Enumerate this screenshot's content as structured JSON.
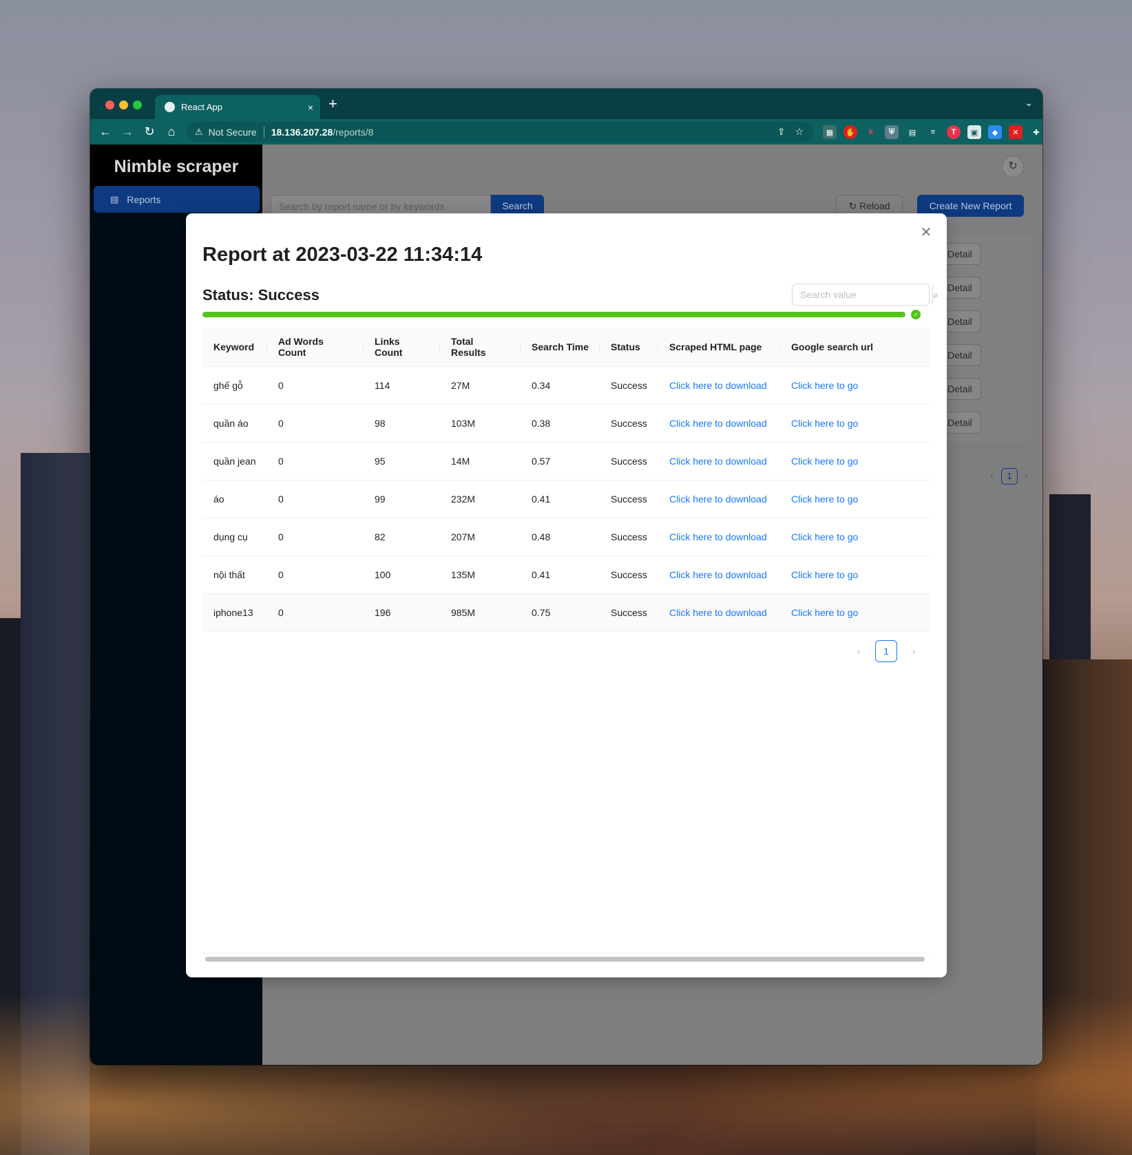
{
  "browser": {
    "tab_title": "React App",
    "tab_close": "×",
    "new_tab": "+",
    "tabs_menu": "⌄",
    "not_secure": "Not Secure",
    "url_host": "18.136.207.28",
    "url_path": "/reports/8"
  },
  "app": {
    "brand": "Nimble scraper",
    "menu_reports": "Reports",
    "search_placeholder": "Search by report name or by keywords",
    "search_button": "Search",
    "reload_button": "Reload",
    "create_button": "Create New Report",
    "detail_label": "Detail",
    "page_number": "1"
  },
  "modal": {
    "title": "Report at 2023-03-22 11:34:14",
    "status": "Status: Success",
    "search_placeholder": "Search value",
    "progress_percent": 100,
    "columns": [
      "Keyword",
      "Ad Words Count",
      "Links Count",
      "Total Results",
      "Search Time",
      "Status",
      "Scraped HTML page",
      "Google search url"
    ],
    "rows": [
      {
        "keyword": "ghế gỗ",
        "ad_words": "0",
        "links": "114",
        "total": "27M",
        "time": "0.34",
        "status": "Success",
        "html": "Click here to download",
        "url": "Click here to go"
      },
      {
        "keyword": "quần áo",
        "ad_words": "0",
        "links": "98",
        "total": "103M",
        "time": "0.38",
        "status": "Success",
        "html": "Click here to download",
        "url": "Click here to go"
      },
      {
        "keyword": "quần jean",
        "ad_words": "0",
        "links": "95",
        "total": "14M",
        "time": "0.57",
        "status": "Success",
        "html": "Click here to download",
        "url": "Click here to go"
      },
      {
        "keyword": "áo",
        "ad_words": "0",
        "links": "99",
        "total": "232M",
        "time": "0.41",
        "status": "Success",
        "html": "Click here to download",
        "url": "Click here to go"
      },
      {
        "keyword": "dụng cụ",
        "ad_words": "0",
        "links": "82",
        "total": "207M",
        "time": "0.48",
        "status": "Success",
        "html": "Click here to download",
        "url": "Click here to go"
      },
      {
        "keyword": "nội thất",
        "ad_words": "0",
        "links": "100",
        "total": "135M",
        "time": "0.41",
        "status": "Success",
        "html": "Click here to download",
        "url": "Click here to go"
      },
      {
        "keyword": "iphone13",
        "ad_words": "0",
        "links": "196",
        "total": "985M",
        "time": "0.75",
        "status": "Success",
        "html": "Click here to download",
        "url": "Click here to go"
      }
    ],
    "page_number": "1"
  },
  "colors": {
    "success": "#52c41a",
    "link": "#1677ff",
    "primary": "#1677ff",
    "chrome": "#0e6161"
  }
}
